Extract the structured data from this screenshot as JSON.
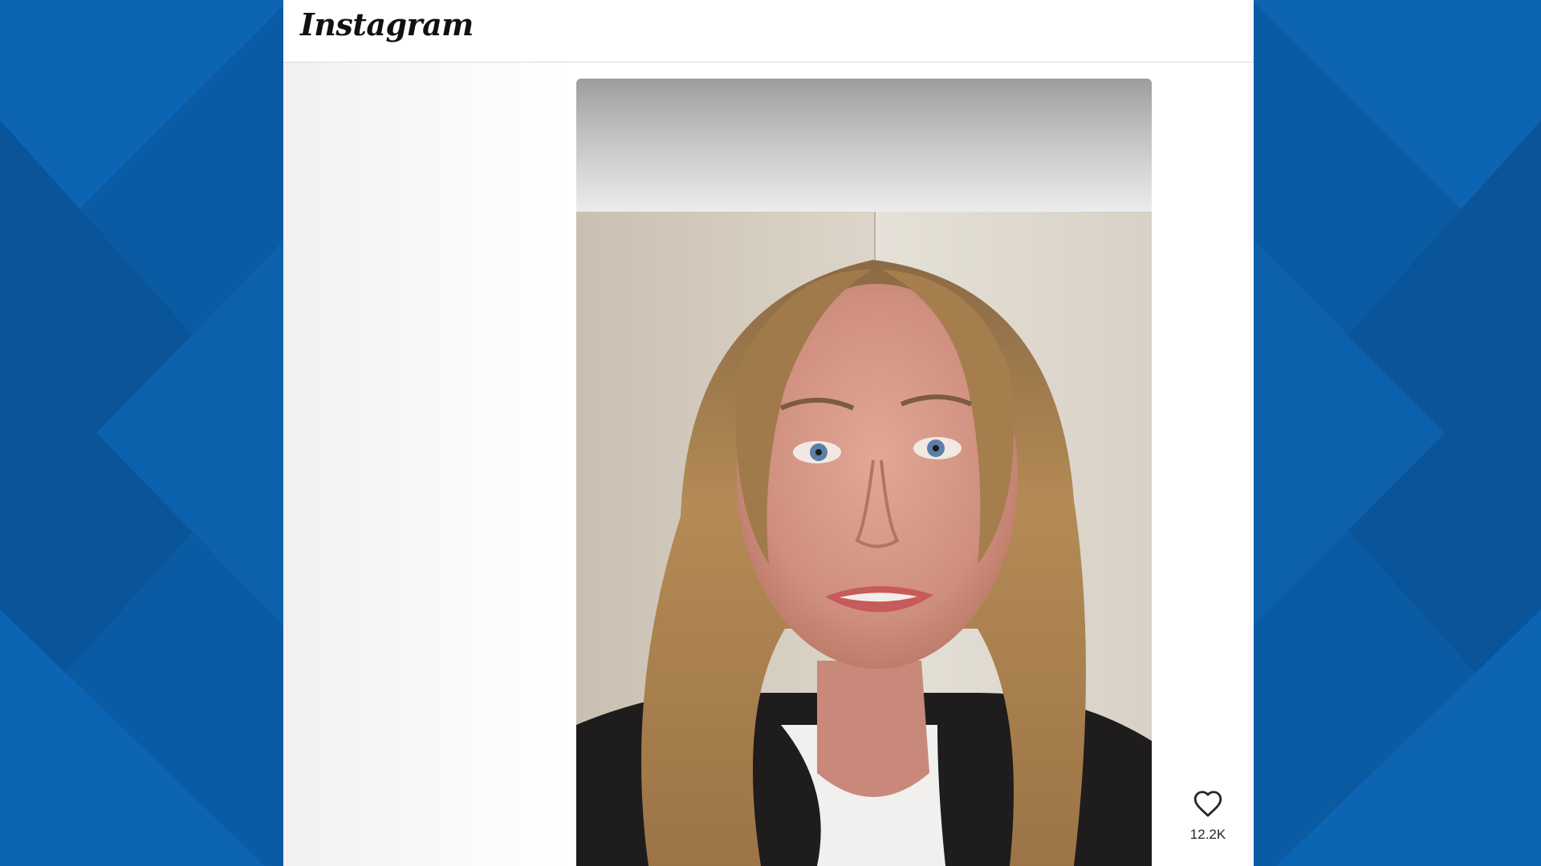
{
  "header": {
    "logo_text": "Instagram"
  },
  "post": {
    "media_type": "video",
    "like_count": "12.2K"
  },
  "icons": {
    "like": "heart-icon"
  },
  "colors": {
    "backdrop_blue": "#0a5aa3",
    "panel_white": "#ffffff",
    "header_border": "#dbdbdb",
    "text_dark": "#262626"
  }
}
